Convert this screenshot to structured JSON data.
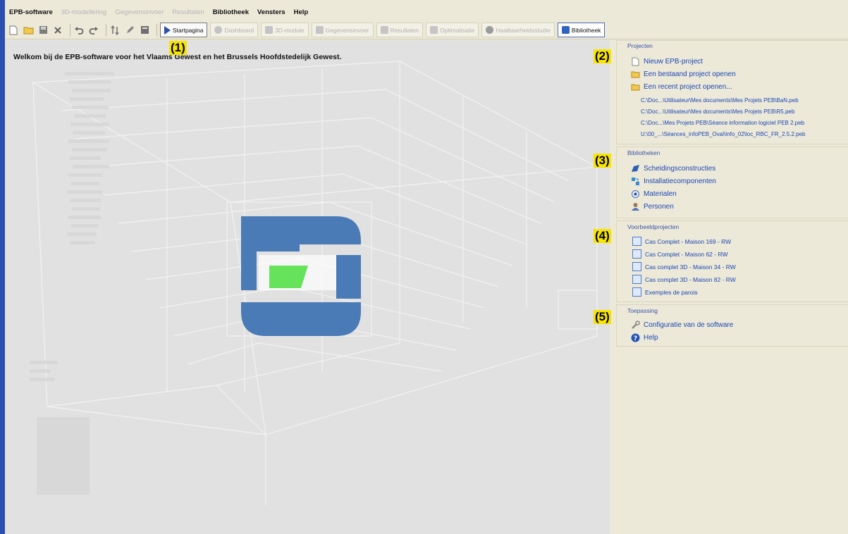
{
  "menubar": {
    "items": [
      {
        "label": "EPB-software",
        "enabled": true
      },
      {
        "label": "3D-modellering",
        "enabled": false
      },
      {
        "label": "Gegevensinvoer",
        "enabled": false
      },
      {
        "label": "Resultaten",
        "enabled": false
      },
      {
        "label": "Bibliotheek",
        "enabled": true
      },
      {
        "label": "Vensters",
        "enabled": true
      },
      {
        "label": "Help",
        "enabled": true
      }
    ]
  },
  "toolbar": {
    "icons": [
      "new-file-icon",
      "open-folder-icon",
      "save-icon",
      "delete-icon",
      "undo-icon",
      "redo-icon",
      "refresh-icon",
      "edit-icon",
      "calculator-icon"
    ],
    "startpagina_label": "Startpagina",
    "dashboard_label": "Dashboard",
    "module3d_label": "3D-module",
    "gegevensinvoer_label": "Gegevensinvoer",
    "resultaten_label": "Resultaten",
    "optimalisatie_label": "Optimalisatie",
    "haalbaarheid_label": "Haalbaarheidsstudie",
    "bibliotheek_label": "Bibliotheek"
  },
  "main": {
    "welcome_text": "Welkom bij de EPB-software voor het Vlaams Gewest en het Brussels Hoofdstedelijk Gewest."
  },
  "callouts": {
    "c1": "(1)",
    "c2": "(2)",
    "c3": "(3)",
    "c4": "(4)",
    "c5": "(5)"
  },
  "panel": {
    "projecten": {
      "title": "Projecten",
      "new_project": "Nieuw EPB-project",
      "open_existing": "Een bestaand project openen",
      "open_recent": "Een recent project openen...",
      "recent_files": [
        "C:\\Doc...\\Utilisateur\\Mes documents\\Mes Projets PEB\\BaN.peb",
        "C:\\Doc...\\Utilisateur\\Mes documents\\Mes Projets PEB\\R5.peb",
        "C:\\Doc...\\Mes Projets PEB\\Séance information logiciel PEB 2.peb",
        "U:\\00_...\\Séances_infoPEB_Oval\\Info_02\\loc_RBC_FR_2.5.2.peb"
      ]
    },
    "bibliotheken": {
      "title": "Bibliotheken",
      "items": [
        "Scheidingsconstructies",
        "Installatiecomponenten",
        "Materialen",
        "Personen"
      ]
    },
    "voorbeeldprojecten": {
      "title": "Voorbeeldprojecten",
      "items": [
        "Cas Complet - Maison 169 - RW",
        "Cas Complet - Maison 62 - RW",
        "Cas complet 3D - Maison 34 - RW",
        "Cas complet 3D - Maison 82 - RW",
        "Exemples de parois"
      ]
    },
    "toepassing": {
      "title": "Toepassing",
      "config_label": "Configuratie van de software",
      "help_label": "Help"
    }
  },
  "colors": {
    "accent_blue": "#2b4fb0",
    "link_blue": "#1c46b5",
    "callout_yellow": "#f7e400",
    "logo_blue": "#4a7bb7",
    "logo_green": "#66e25b"
  }
}
